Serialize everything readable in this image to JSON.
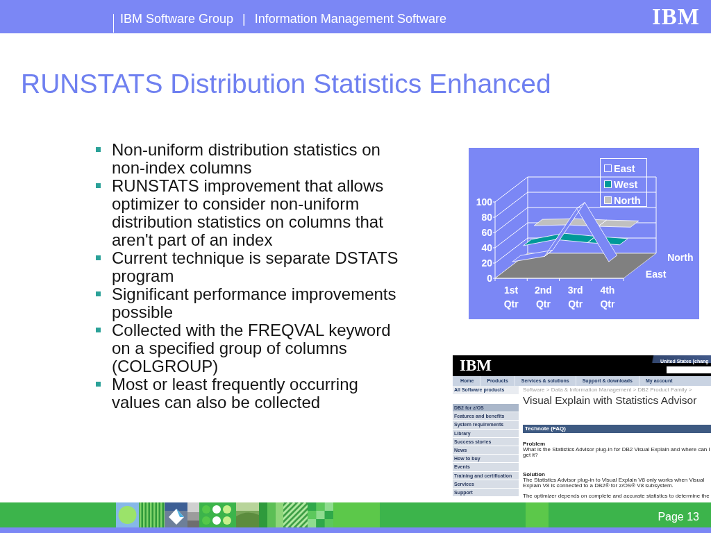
{
  "header": {
    "group": "IBM Software Group",
    "separator": "|",
    "division": "Information Management Software",
    "logo": "IBM"
  },
  "title": "RUNSTATS Distribution Statistics Enhanced",
  "bullets": [
    "Non-uniform distribution statistics on non-index columns",
    "RUNSTATS improvement that allows optimizer to consider non-uniform distribution statistics on columns that aren't part of an index",
    "Current technique is separate DSTATS program",
    "Significant performance improvements possible",
    "Collected with the FREQVAL keyword on a specified group of columns (COLGROUP)",
    "Most or least frequently occurring values can also be collected"
  ],
  "chart": {
    "legend": [
      {
        "label": "East",
        "color": "#7b87f5"
      },
      {
        "label": "West",
        "color": "#009999"
      },
      {
        "label": "North",
        "color": "#c0c0c0"
      }
    ],
    "y_axis_labels": [
      "100",
      "80",
      "60",
      "40",
      "20",
      "0"
    ],
    "x_axis_labels": [
      "1st Qtr",
      "2nd Qtr",
      "3rd Qtr",
      "4th Qtr"
    ],
    "depth_axis_labels": [
      "North",
      "East"
    ]
  },
  "web_page": {
    "logo": "IBM",
    "locale": "United States [chang",
    "nav": [
      "Home",
      "Products",
      "Services & solutions",
      "Support & downloads",
      "My account"
    ],
    "all_products": "All Software products",
    "breadcrumb": "Software > Data & Information Management > DB2 Product Family >",
    "title": "Visual Explain with Statistics Advisor",
    "side_nav": [
      {
        "label": "DB2 for z/OS",
        "selected": true
      },
      {
        "label": "Features and benefits",
        "selected": false
      },
      {
        "label": "System requirements",
        "selected": false
      },
      {
        "label": "Library",
        "selected": false
      },
      {
        "label": "Success stories",
        "selected": false
      },
      {
        "label": "News",
        "selected": false
      },
      {
        "label": "How to buy",
        "selected": false
      },
      {
        "label": "Events",
        "selected": false
      },
      {
        "label": "Training and certification",
        "selected": false
      },
      {
        "label": "Services",
        "selected": false
      },
      {
        "label": "Support",
        "selected": false
      }
    ],
    "technote": "Technote (FAQ)",
    "sections": [
      {
        "heading": "Problem",
        "text": "What is the Statistics Advisor plug-in for DB2 Visual Explain and where can I get it?"
      },
      {
        "heading": "Solution",
        "text": "The Statistics Advisor plug-in to Visual Explain V8 only works when Visual Explain V8 is connected to a DB2® for z/OS® V8 subsystem."
      }
    ],
    "cut_text": "The optimizer depends on complete and accurate statistics to determine the"
  },
  "footer": {
    "page": "Page 13"
  }
}
